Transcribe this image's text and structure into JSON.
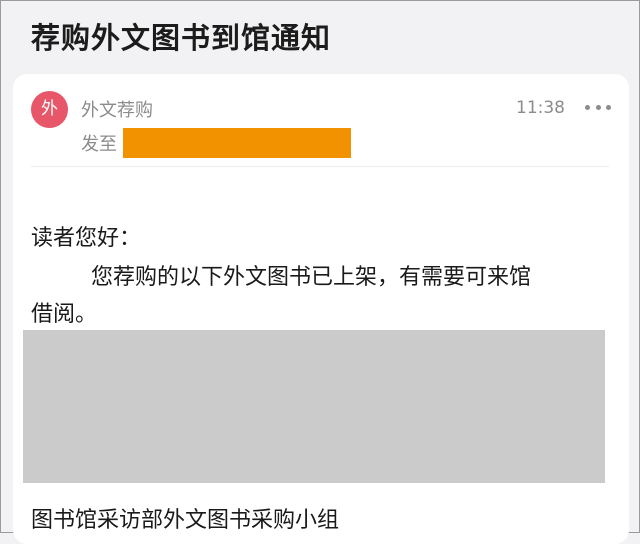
{
  "header": {
    "title": "荐购外文图书到馆通知"
  },
  "message": {
    "avatar_char": "外",
    "sender": "外文荐购",
    "time": "11:38",
    "recipient_prefix": "发至",
    "greeting": "读者您好：",
    "body_line1": "您荐购的以下外文图书已上架，有需要可来馆",
    "body_line2": "借阅。",
    "signature": "图书馆采访部外文图书采购小组"
  },
  "icons": {
    "more": "more-horizontal-icon"
  },
  "colors": {
    "avatar_bg": "#e8566a",
    "recipient_redaction": "#f39200",
    "content_redaction": "#cbcbcb"
  }
}
